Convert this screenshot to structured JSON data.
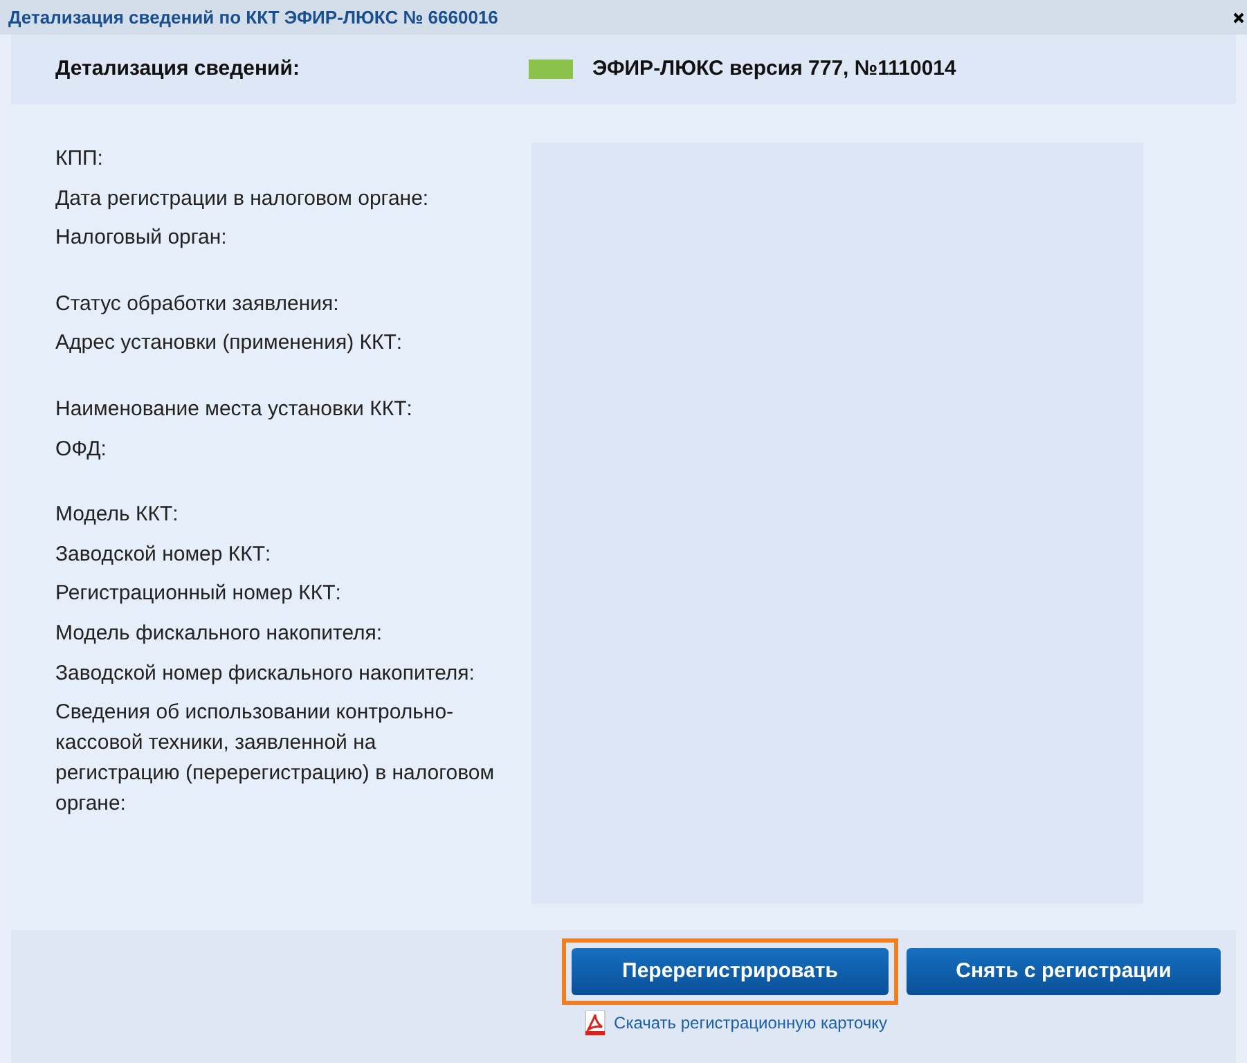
{
  "window": {
    "title": "Детализация сведений по ККТ ЭФИР-ЛЮКС № 6660016"
  },
  "header": {
    "label": "Детализация сведений:",
    "active": true,
    "device": "ЭФИР-ЛЮКС версия 777, №1110014"
  },
  "groups": [
    {
      "labels": [
        "КПП:",
        "Дата регистрации в налоговом органе:",
        "Налоговый орган:"
      ]
    },
    {
      "labels": [
        "Статус обработки заявления:",
        "Адрес установки (применения) ККТ:"
      ]
    },
    {
      "labels": [
        "Наименование места установки ККТ:",
        "ОФД:"
      ]
    },
    {
      "labels": [
        "Модель ККТ:",
        "Заводской номер ККТ:",
        "Регистрационный номер ККТ:",
        "Модель фискального накопителя:",
        "Заводской номер фискального накопителя:",
        "Сведения об использовании контрольно-кассовой техники, заявленной на регистрацию (перерегистрацию) в налоговом органе:"
      ]
    }
  ],
  "buttons": [
    {
      "label": "Перерегистрировать",
      "highlighted": true
    },
    {
      "label": "Снять с регистрации",
      "highlighted": false
    }
  ],
  "download_link": "Скачать регистрационную карточку"
}
